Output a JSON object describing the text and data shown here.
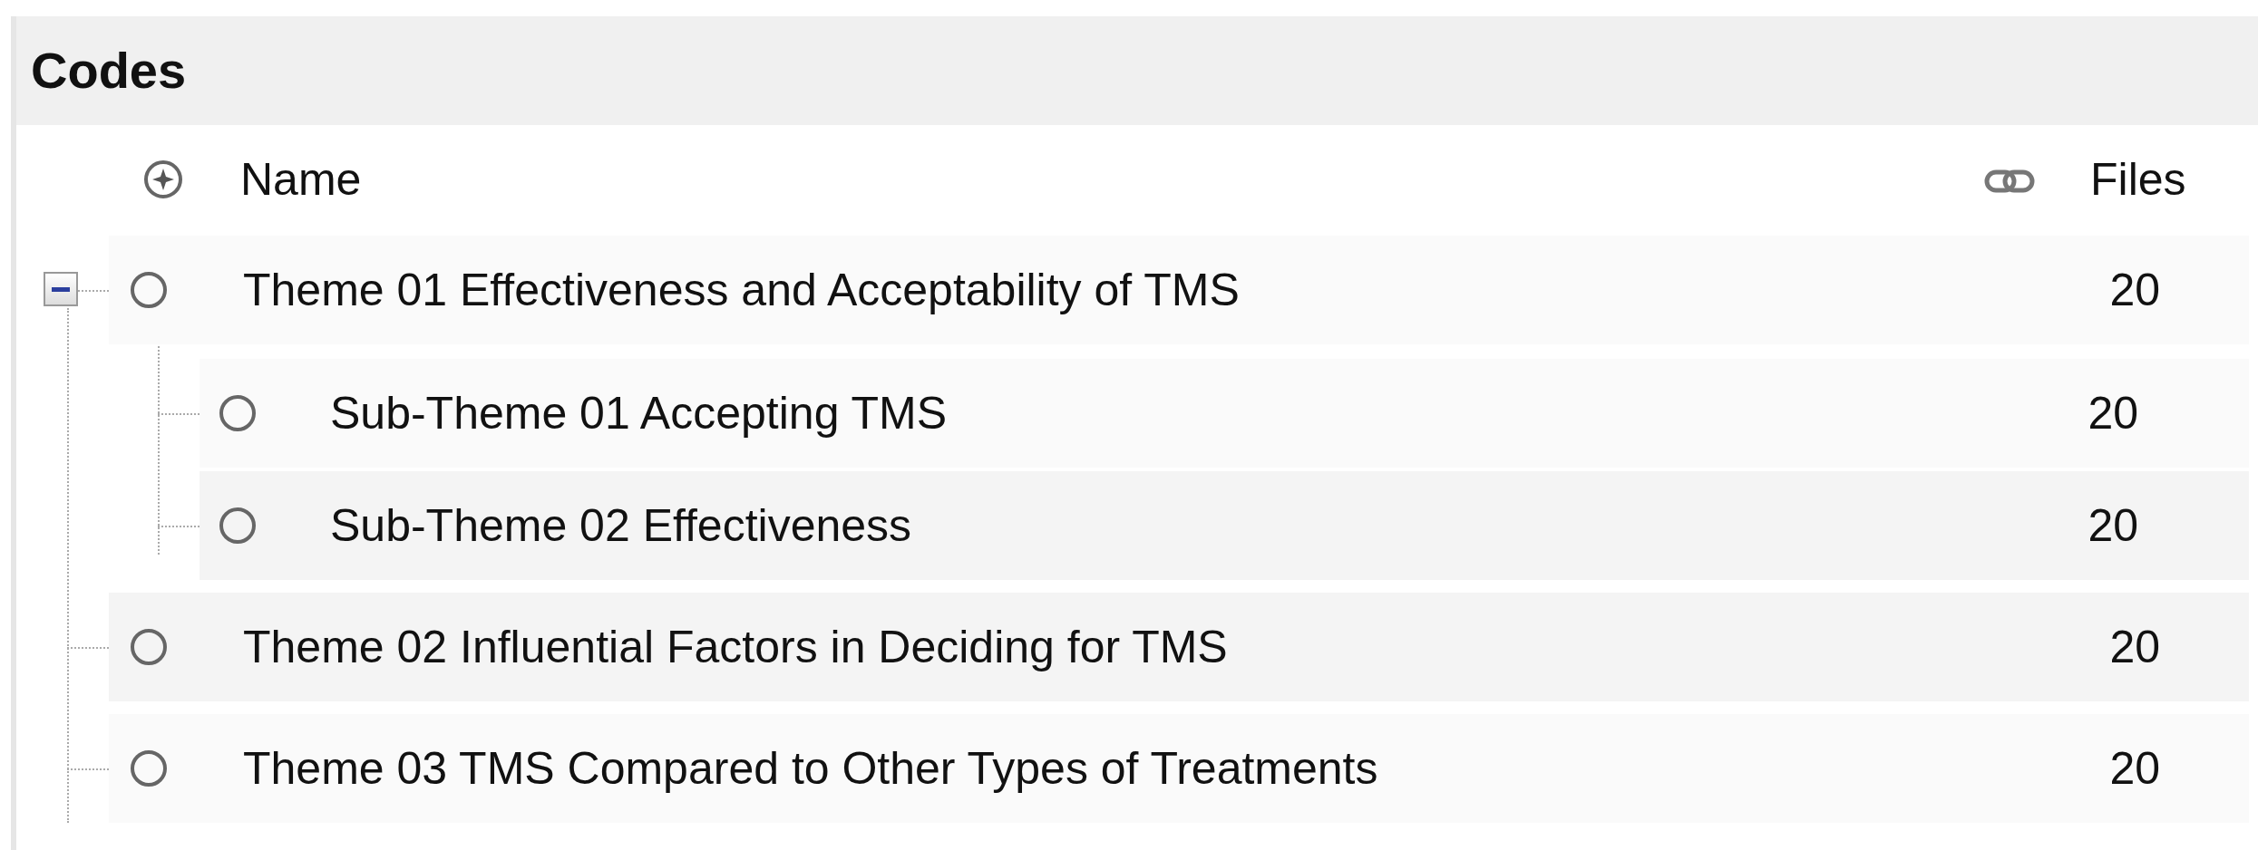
{
  "panel": {
    "title": "Codes"
  },
  "columns": [
    "Name",
    "Files"
  ],
  "codes": [
    {
      "name": "Theme 01 Effectiveness and Acceptability of TMS",
      "files": "20",
      "expanded": true,
      "children": [
        {
          "name": "Sub-Theme 01 Accepting TMS",
          "files": "20"
        },
        {
          "name": "Sub-Theme 02 Effectiveness",
          "files": "20"
        }
      ]
    },
    {
      "name": "Theme 02 Influential Factors in Deciding for TMS",
      "files": "20"
    },
    {
      "name": "Theme 03 TMS Compared to Other Types of Treatments",
      "files": "20"
    }
  ]
}
